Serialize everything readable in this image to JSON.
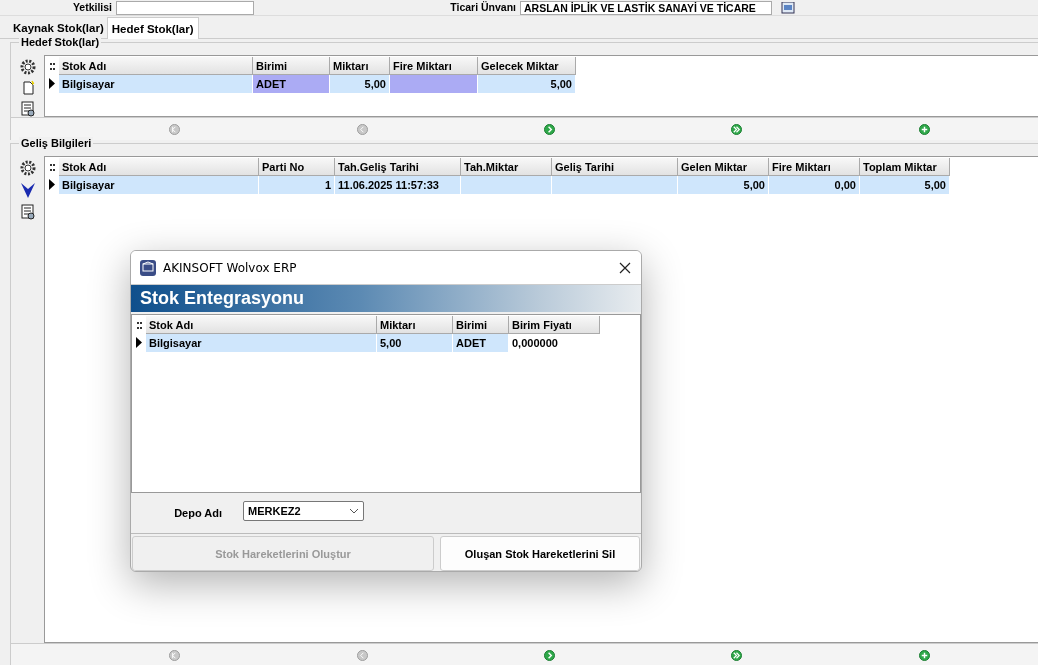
{
  "top_fields": [
    {
      "label": "Yetkilisi"
    },
    {
      "label": "Ticari Ünvanı",
      "value": "ARSLAN İPLİK VE LASTİK SANAYİ VE TİCARE"
    }
  ],
  "tabs": [
    {
      "label": "Kaynak Stok(lar)",
      "selected": false
    },
    {
      "label": "Hedef Stok(lar)",
      "selected": true
    }
  ],
  "panels": [
    {
      "title": "Hedef Stok(lar)",
      "tools": [
        {
          "kind": "gear"
        },
        {
          "kind": "document"
        },
        {
          "kind": "report"
        }
      ],
      "columns": [
        "Stok Adı",
        "Birimi",
        "Miktarı",
        "Fire Miktarı",
        "Gelecek Miktar"
      ],
      "rows": [
        {
          "cells": [
            {
              "text": "Bilgisayar",
              "color": "#cfe6fc"
            },
            {
              "text": "ADET",
              "color": "#ababf4"
            },
            {
              "text": "5,00",
              "color": "#cfe6fc"
            },
            {
              "color": "#ababf4"
            },
            {
              "text": "5,00",
              "color": "#cfe6fc"
            }
          ]
        }
      ],
      "nav": [
        {
          "kind": "first",
          "disabled": true
        },
        {
          "kind": "prev",
          "disabled": true
        },
        {
          "kind": "next",
          "disabled": false
        },
        {
          "kind": "last",
          "disabled": false
        },
        {
          "kind": "add",
          "disabled": false
        }
      ]
    },
    {
      "title": "Geliş Bilgileri",
      "tools": [
        {
          "kind": "gear"
        },
        {
          "kind": "down"
        },
        {
          "kind": "report"
        }
      ],
      "columns": [
        "Stok Adı",
        "Parti No",
        "Tah.Geliş Tarihi",
        "Tah.Miktar",
        "Geliş Tarihi",
        "Gelen Miktar",
        "Fire Miktarı",
        "Toplam Miktar"
      ],
      "rows": [
        {
          "cells": [
            {
              "text": "Bilgisayar",
              "color": "#cfe6fc"
            },
            {
              "text": "1",
              "color": "#cfe6fc"
            },
            {
              "text": "11.06.2025 11:57:33",
              "color": "#cfe6fc"
            },
            {
              "color": "#cfe6fc"
            },
            {
              "color": "#cfe6fc"
            },
            {
              "text": "5,00",
              "color": "#cfe6fc"
            },
            {
              "text": "0,00",
              "color": "#cfe6fc"
            },
            {
              "text": "5,00",
              "color": "#cfe6fc"
            }
          ]
        }
      ],
      "nav": [
        {
          "kind": "first",
          "disabled": true
        },
        {
          "kind": "prev",
          "disabled": true
        },
        {
          "kind": "next",
          "disabled": false
        },
        {
          "kind": "last",
          "disabled": false
        },
        {
          "kind": "add",
          "disabled": false
        }
      ]
    }
  ],
  "dialog": {
    "title": "AKINSOFT Wolvox ERP",
    "banner": "Stok Entegrasyonu",
    "columns": [
      "Stok Adı",
      "Miktarı",
      "Birimi",
      "Birim Fiyatı"
    ],
    "rows": [
      {
        "cells": [
          {
            "text": "Bilgisayar",
            "color": "#cfe6fc"
          },
          {
            "text": "5,00",
            "color": "#cfe6fc"
          },
          {
            "text": "ADET",
            "color": "#cfe6fc"
          },
          {
            "text": "0,000000",
            "color": "#ffffff"
          }
        ]
      }
    ],
    "depo_label": "Depo Adı",
    "depo_value": "MERKEZ2",
    "buttons": [
      {
        "label": "Stok Hareketlerini Oluştur",
        "disabled": true
      },
      {
        "label": "Oluşan Stok Hareketlerini Sil",
        "disabled": false
      }
    ]
  }
}
